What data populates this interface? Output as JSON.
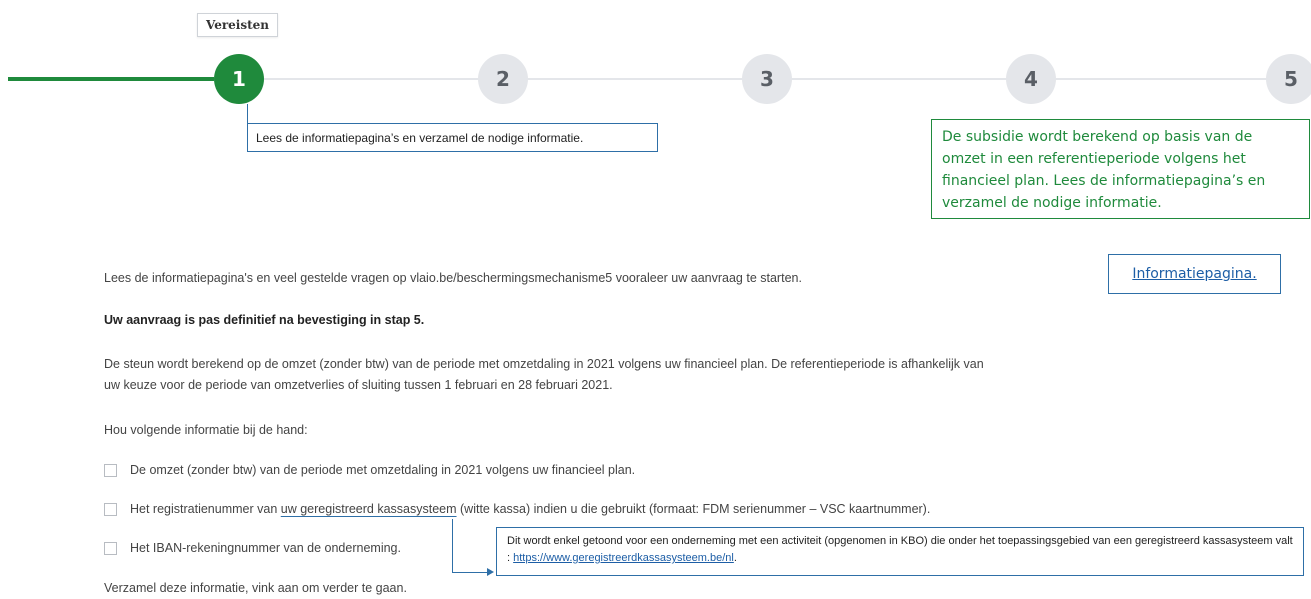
{
  "stepper": {
    "tooltip": "Vereisten",
    "steps": [
      {
        "label": "1",
        "active": true
      },
      {
        "label": "2",
        "active": false
      },
      {
        "label": "3",
        "active": false
      },
      {
        "label": "4",
        "active": false
      },
      {
        "label": "5",
        "active": false
      }
    ]
  },
  "callouts": {
    "step1_note": "Lees de informatiepagina’s en verzamel de nodige informatie.",
    "subsidy_note": "De subsidie wordt berekend op basis van de omzet in een referentieperiode volgens het financieel plan. Lees de informatiepagina’s en verzamel de nodige informatie.",
    "info_link": "Informatiepagina.",
    "kassa_note_text": "Dit wordt enkel getoond voor een onderneming met een activiteit (opgenomen in KBO) die onder het toepassingsgebied van een geregistreerd kassasysteem valt : ",
    "kassa_note_link": "https://www.geregistreerdkassasysteem.be/nl",
    "kassa_note_end": "."
  },
  "content": {
    "intro": "Lees de informatiepagina's en veel gestelde vragen op vlaio.be/beschermingsmechanisme5 vooraleer uw aanvraag te starten.",
    "definitive": "Uw aanvraag is pas definitief na bevestiging in stap 5.",
    "support_line1": "De steun wordt berekend op de omzet (zonder btw) van de periode met omzetdaling in 2021 volgens uw financieel plan. De referentieperiode is afhankelijk van",
    "support_line2": "uw keuze voor de periode van omzetverlies of sluiting tussen 1 februari en 28 februari 2021.",
    "keep_at_hand": "Hou volgende informatie bij de hand:",
    "checklist": {
      "item1": "De omzet (zonder btw) van de periode met omzetdaling in 2021 volgens uw financieel plan.",
      "item2_pre": "Het registratienummer van ",
      "item2_mid": "uw geregistreerd kassasysteem",
      "item2_post": " (witte kassa) indien u die gebruikt (formaat: FDM serienummer – VSC kaartnummer).",
      "item3": "Het IBAN-rekeningnummer van de onderneming."
    },
    "collect": "Verzamel deze informatie, vink aan om verder te gaan."
  }
}
